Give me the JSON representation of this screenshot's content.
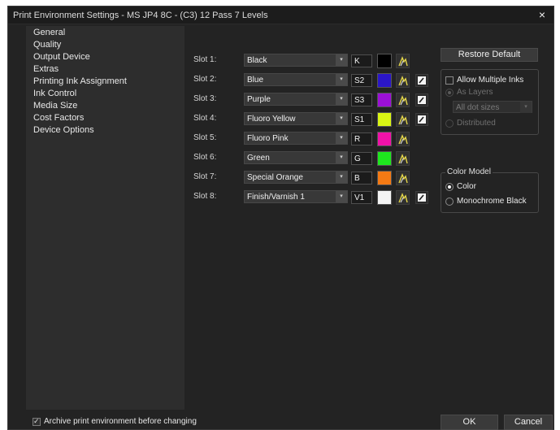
{
  "window": {
    "title": "Print Environment Settings - MS JP4 8C - (C3) 12 Pass 7 Levels",
    "close_glyph": "×"
  },
  "nav": {
    "items": [
      {
        "label": "General"
      },
      {
        "label": "Quality"
      },
      {
        "label": "Output Device"
      },
      {
        "label": "Extras"
      },
      {
        "label": "Printing Ink Assignment"
      },
      {
        "label": "Ink Control"
      },
      {
        "label": "Media Size"
      },
      {
        "label": "Cost Factors"
      },
      {
        "label": "Device Options"
      }
    ]
  },
  "slots": [
    {
      "label": "Slot 1:",
      "ink": "Black",
      "code": "K",
      "color": "#000000",
      "has_edit": false
    },
    {
      "label": "Slot 2:",
      "ink": "Blue",
      "code": "S2",
      "color": "#2b16c8",
      "has_edit": true
    },
    {
      "label": "Slot 3:",
      "ink": "Purple",
      "code": "S3",
      "color": "#9b10d6",
      "has_edit": true
    },
    {
      "label": "Slot 4:",
      "ink": "Fluoro Yellow",
      "code": "S1",
      "color": "#d9f514",
      "has_edit": true
    },
    {
      "label": "Slot 5:",
      "ink": "Fluoro Pink",
      "code": "R",
      "color": "#f012a8",
      "has_edit": false
    },
    {
      "label": "Slot 6:",
      "ink": "Green",
      "code": "G",
      "color": "#1ee71e",
      "has_edit": false
    },
    {
      "label": "Slot 7:",
      "ink": "Special Orange",
      "code": "B",
      "color": "#f57a14",
      "has_edit": false
    },
    {
      "label": "Slot 8:",
      "ink": "Finish/Varnish 1",
      "code": "V1",
      "color": "#f4f4f4",
      "has_edit": true
    }
  ],
  "icons": {
    "curve": "ink-curve-icon",
    "edit": "edit-icon",
    "dropdown": "chevron-down-icon"
  },
  "restore_default": {
    "label": "Restore Default"
  },
  "multiple_inks": {
    "checkbox_label": "Allow Multiple Inks",
    "checked": false,
    "as_layers_label": "As Layers",
    "dot_sizes_value": "All dot sizes",
    "distributed_label": "Distributed"
  },
  "color_model": {
    "group_label": "Color Model",
    "options": [
      {
        "label": "Color",
        "selected": true
      },
      {
        "label": "Monochrome Black",
        "selected": false
      }
    ]
  },
  "footer": {
    "archive_label": "Archive print environment before changing",
    "archive_checked": true,
    "check_glyph": "✓",
    "ok_label": "OK",
    "cancel_label": "Cancel"
  }
}
